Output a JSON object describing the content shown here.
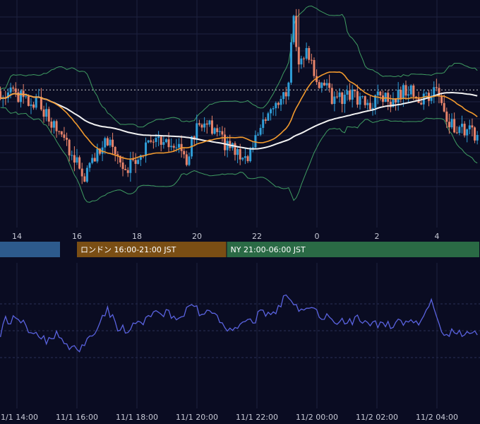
{
  "chart_data": [
    {
      "type": "candlestick",
      "title": "",
      "x_tick_labels": [
        "14",
        "16",
        "18",
        "20",
        "22",
        "0",
        "2",
        "4"
      ],
      "x_tick_hours": [
        14,
        16,
        18,
        20,
        22,
        24,
        26,
        28
      ],
      "x_range_hours": [
        13.45,
        29.4
      ],
      "price_range_relative": [
        0,
        100
      ],
      "reference_level": 60.5,
      "grid": true,
      "colors": {
        "up": "#2f9ed8",
        "down": "#e7836a",
        "moving_average_short": "#f29a2e",
        "moving_average_long": "#f2f2f2",
        "bollinger_bands": "#3f9c62",
        "reference_line": "#c8c8c8",
        "background": "#0a0c22",
        "grid": "#1e2240"
      },
      "overlays": [
        "moving-average-short",
        "moving-average-long",
        "bollinger-bands",
        "reference-line"
      ],
      "sessions": [
        {
          "label": "",
          "start_hour": 13.45,
          "end_hour": 15.45,
          "color": "#2d5a8c"
        },
        {
          "label": "ロンドン 16:00-21:00 JST",
          "start_hour": 16.0,
          "end_hour": 21.0,
          "color": "#7a4e14"
        },
        {
          "label": "NY 21:00-06:00 JST",
          "start_hour": 21.0,
          "end_hour": 30.0,
          "color": "#2a6a45"
        }
      ]
    },
    {
      "type": "line",
      "title": "",
      "x_tick_labels": [
        "11/1 14:00",
        "11/1 16:00",
        "11/1 18:00",
        "11/1 20:00",
        "11/1 22:00",
        "11/2 00:00",
        "11/2 02:00",
        "11/2 04:00"
      ],
      "series_color": "#5a63e0",
      "grid": true,
      "y_range": [
        0,
        100
      ],
      "sampled_values": [
        {
          "hour": 13.5,
          "value": 55
        },
        {
          "hour": 14.0,
          "value": 58
        },
        {
          "hour": 14.5,
          "value": 47
        },
        {
          "hour": 15.0,
          "value": 40
        },
        {
          "hour": 15.4,
          "value": 46
        },
        {
          "hour": 15.8,
          "value": 33
        },
        {
          "hour": 16.2,
          "value": 37
        },
        {
          "hour": 16.6,
          "value": 46
        },
        {
          "hour": 17.0,
          "value": 66
        },
        {
          "hour": 17.4,
          "value": 49
        },
        {
          "hour": 17.8,
          "value": 51
        },
        {
          "hour": 18.2,
          "value": 56
        },
        {
          "hour": 18.6,
          "value": 64
        },
        {
          "hour": 19.0,
          "value": 61
        },
        {
          "hour": 19.4,
          "value": 57
        },
        {
          "hour": 19.8,
          "value": 67
        },
        {
          "hour": 20.2,
          "value": 61
        },
        {
          "hour": 20.6,
          "value": 59
        },
        {
          "hour": 21.0,
          "value": 48
        },
        {
          "hour": 21.4,
          "value": 54
        },
        {
          "hour": 21.8,
          "value": 54
        },
        {
          "hour": 22.2,
          "value": 63
        },
        {
          "hour": 22.6,
          "value": 60
        },
        {
          "hour": 23.0,
          "value": 78
        },
        {
          "hour": 23.4,
          "value": 63
        },
        {
          "hour": 23.8,
          "value": 68
        },
        {
          "hour": 24.2,
          "value": 59
        },
        {
          "hour": 24.6,
          "value": 56
        },
        {
          "hour": 25.0,
          "value": 55
        },
        {
          "hour": 25.4,
          "value": 57
        },
        {
          "hour": 25.8,
          "value": 55
        },
        {
          "hour": 26.2,
          "value": 52
        },
        {
          "hour": 26.6,
          "value": 53
        },
        {
          "hour": 27.0,
          "value": 57
        },
        {
          "hour": 27.4,
          "value": 55
        },
        {
          "hour": 27.8,
          "value": 70
        },
        {
          "hour": 28.2,
          "value": 45
        },
        {
          "hour": 28.6,
          "value": 47
        },
        {
          "hour": 29.0,
          "value": 47
        },
        {
          "hour": 29.4,
          "value": 47
        }
      ]
    }
  ]
}
